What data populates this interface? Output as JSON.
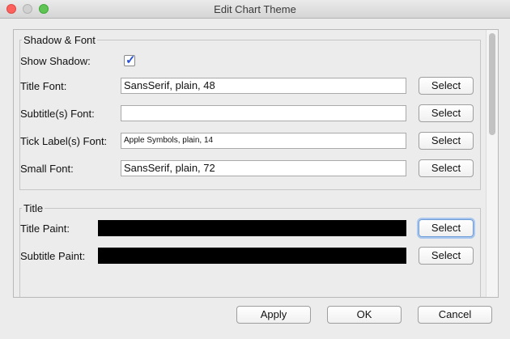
{
  "window": {
    "title": "Edit Chart Theme"
  },
  "shadow_font": {
    "group_title": "Shadow & Font",
    "show_shadow_label": "Show Shadow:",
    "show_shadow_checked": true,
    "title_font_label": "Title Font:",
    "title_font_value": "SansSerif, plain, 48",
    "subtitle_font_label": "Subtitle(s) Font:",
    "subtitle_font_value": "",
    "tick_label_font_label": "Tick Label(s) Font:",
    "tick_label_font_value": "Apple Symbols, plain, 14",
    "small_font_label": "Small Font:",
    "small_font_value": "SansSerif, plain, 72",
    "select_label": "Select"
  },
  "title_group": {
    "group_title": "Title",
    "title_paint_label": "Title Paint:",
    "title_paint_color": "#000000",
    "subtitle_paint_label": "Subtitle Paint:",
    "subtitle_paint_color": "#000000",
    "select_label": "Select"
  },
  "buttons": {
    "apply": "Apply",
    "ok": "OK",
    "cancel": "Cancel"
  }
}
